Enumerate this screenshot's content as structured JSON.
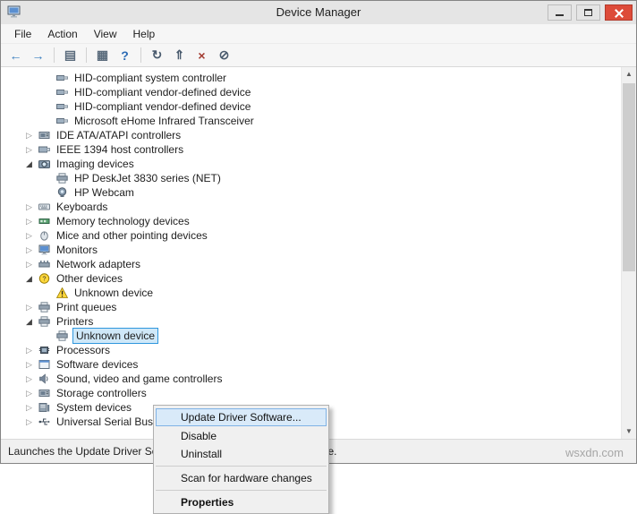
{
  "window": {
    "title": "Device Manager",
    "status": "Launches the Update Driver Software Wizard for the selected device.",
    "watermark": "wsxdn.com"
  },
  "menubar": {
    "items": [
      "File",
      "Action",
      "View",
      "Help"
    ]
  },
  "glyphs": {
    "expanded": "◢",
    "collapsed": "▷",
    "scroll_up": "▲",
    "scroll_down": "▼"
  },
  "toolbar": {
    "buttons": [
      {
        "name": "back-button",
        "glyph": "←",
        "color": "#3a7ebf"
      },
      {
        "name": "forward-button",
        "glyph": "→",
        "color": "#3a7ebf"
      },
      {
        "separator": true
      },
      {
        "name": "show-console-tree-button",
        "glyph": "▤",
        "color": "#5a6b7c"
      },
      {
        "separator": true
      },
      {
        "name": "properties-button",
        "glyph": "▦",
        "color": "#5a6b7c"
      },
      {
        "name": "help-button",
        "glyph": "?",
        "color": "#2d6cb5"
      },
      {
        "separator": true
      },
      {
        "name": "scan-hardware-changes-button",
        "glyph": "↻",
        "color": "#4a5b6e"
      },
      {
        "name": "update-driver-software-button",
        "glyph": "⇑",
        "color": "#4a5b6e"
      },
      {
        "name": "uninstall-button",
        "glyph": "×",
        "color": "#a33c32"
      },
      {
        "name": "disable-button",
        "glyph": "⊘",
        "color": "#4a5b6e"
      }
    ]
  },
  "tree": {
    "items": [
      {
        "label": "HID-compliant system controller",
        "level": 2,
        "icon": "hid-device"
      },
      {
        "label": "HID-compliant vendor-defined device",
        "level": 2,
        "icon": "hid-device"
      },
      {
        "label": "HID-compliant vendor-defined device",
        "level": 2,
        "icon": "hid-device"
      },
      {
        "label": "Microsoft eHome Infrared Transceiver",
        "level": 2,
        "icon": "hid-device"
      },
      {
        "label": "IDE ATA/ATAPI controllers",
        "level": 1,
        "state": "collapsed",
        "icon": "storage-controller"
      },
      {
        "label": "IEEE 1394 host controllers",
        "level": 1,
        "state": "collapsed",
        "icon": "ieee1394"
      },
      {
        "label": "Imaging devices",
        "level": 1,
        "state": "expanded",
        "icon": "imaging-device"
      },
      {
        "label": "HP DeskJet 3830 series (NET)",
        "level": 2,
        "icon": "printer"
      },
      {
        "label": "HP Webcam",
        "level": 2,
        "icon": "webcam"
      },
      {
        "label": "Keyboards",
        "level": 1,
        "state": "collapsed",
        "icon": "keyboard"
      },
      {
        "label": "Memory technology devices",
        "level": 1,
        "state": "collapsed",
        "icon": "memory"
      },
      {
        "label": "Mice and other pointing devices",
        "level": 1,
        "state": "collapsed",
        "icon": "mouse"
      },
      {
        "label": "Monitors",
        "level": 1,
        "state": "collapsed",
        "icon": "monitor"
      },
      {
        "label": "Network adapters",
        "level": 1,
        "state": "collapsed",
        "icon": "network-adapter"
      },
      {
        "label": "Other devices",
        "level": 1,
        "state": "expanded",
        "icon": "other-device"
      },
      {
        "label": "Unknown device",
        "level": 2,
        "icon": "warning"
      },
      {
        "label": "Print queues",
        "level": 1,
        "state": "collapsed",
        "icon": "printer"
      },
      {
        "label": "Printers",
        "level": 1,
        "state": "expanded",
        "icon": "printer"
      },
      {
        "label": "Unknown device",
        "level": 2,
        "icon": "printer",
        "selected": true
      },
      {
        "label": "Processors",
        "level": 1,
        "state": "collapsed",
        "icon": "processor"
      },
      {
        "label": "Software devices",
        "level": 1,
        "state": "collapsed",
        "icon": "software-device"
      },
      {
        "label": "Sound, video and game controllers",
        "level": 1,
        "state": "collapsed",
        "icon": "sound"
      },
      {
        "label": "Storage controllers",
        "level": 1,
        "state": "collapsed",
        "icon": "storage-controller"
      },
      {
        "label": "System devices",
        "level": 1,
        "state": "collapsed",
        "icon": "system-device"
      },
      {
        "label": "Universal Serial Bus controllers",
        "level": 1,
        "state": "collapsed",
        "icon": "usb"
      }
    ]
  },
  "context_menu": {
    "items": [
      {
        "label": "Update Driver Software...",
        "highlighted": true
      },
      {
        "label": "Disable"
      },
      {
        "label": "Uninstall"
      },
      {
        "separator": true
      },
      {
        "label": "Scan for hardware changes"
      },
      {
        "separator": true
      },
      {
        "label": "Properties",
        "bold": true
      }
    ]
  }
}
